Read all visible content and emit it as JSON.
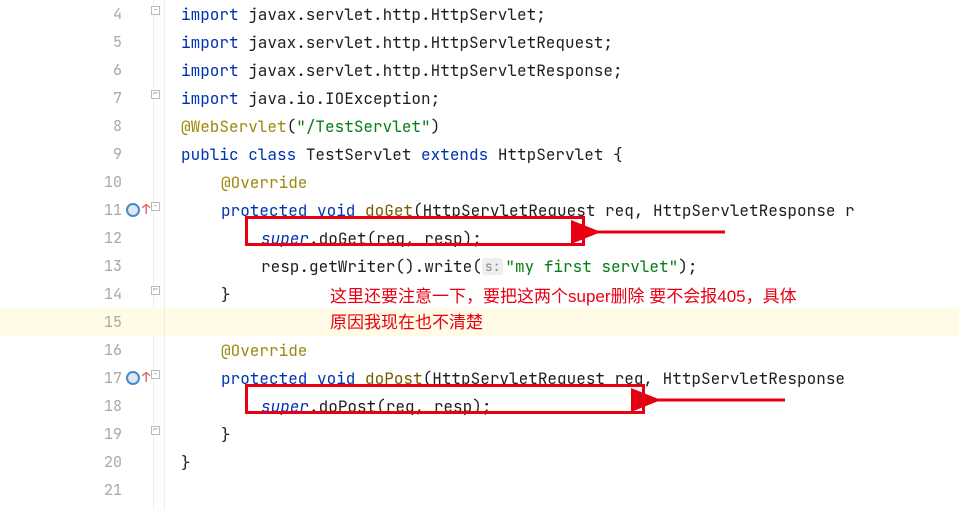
{
  "gutter": {
    "lines": [
      {
        "n": "4",
        "fold": "minus"
      },
      {
        "n": "5"
      },
      {
        "n": "6"
      },
      {
        "n": "7",
        "fold": "end"
      },
      {
        "n": "8"
      },
      {
        "n": "9"
      },
      {
        "n": "10"
      },
      {
        "n": "11",
        "break": true,
        "up": true,
        "fold": "minus"
      },
      {
        "n": "12"
      },
      {
        "n": "13"
      },
      {
        "n": "14",
        "fold": "end"
      },
      {
        "n": "15",
        "hl": true
      },
      {
        "n": "16"
      },
      {
        "n": "17",
        "break": true,
        "up": true,
        "fold": "minus"
      },
      {
        "n": "18"
      },
      {
        "n": "19",
        "fold": "end"
      },
      {
        "n": "20"
      },
      {
        "n": "21"
      }
    ]
  },
  "code": {
    "l4": {
      "kw": "import ",
      "txt": "javax.servlet.http.HttpServlet;"
    },
    "l5": {
      "kw": "import ",
      "txt": "javax.servlet.http.HttpServletRequest;"
    },
    "l6": {
      "kw": "import ",
      "txt": "javax.servlet.http.HttpServletResponse;"
    },
    "l7": {
      "kw": "import ",
      "txt": "java.io.IOException;"
    },
    "l8": {
      "ann": "@WebServlet",
      "args": "(",
      "str": "\"/TestServlet\"",
      "close": ")"
    },
    "l9": {
      "p1": "public class ",
      "cls": "TestServlet ",
      "p2": "extends ",
      "sup": "HttpServlet {"
    },
    "l10": {
      "ann": "@Override"
    },
    "l11": {
      "p1": "protected void ",
      "fn": "doGet",
      "args": "(HttpServletRequest req, HttpServletResponse r"
    },
    "l12": {
      "sup": "super",
      "call": ".doGet(req, resp);"
    },
    "l13": {
      "pre": "resp.getWriter().write(",
      "hint": "s:",
      "str": "\"my first servlet\"",
      "post": ");"
    },
    "l14": {
      "txt": "}"
    },
    "l15": {
      "txt": ""
    },
    "l16": {
      "ann": "@Override"
    },
    "l17": {
      "p1": "protected void ",
      "fn": "doPost",
      "args": "(HttpServletRequest req, HttpServletResponse "
    },
    "l18": {
      "sup": "super",
      "call": ".doPost(req, resp);"
    },
    "l19": {
      "txt": "}"
    },
    "l20": {
      "txt": "}"
    },
    "l21": {
      "txt": ""
    }
  },
  "annotation": {
    "text_line1": "这里还要注意一下，要把这两个super删除 要不会报405，具体",
    "text_line2": "原因我现在也不清楚"
  },
  "colors": {
    "red": "#e60012",
    "keyword": "#0033b3",
    "annotation": "#9e880d",
    "string": "#067d17"
  }
}
